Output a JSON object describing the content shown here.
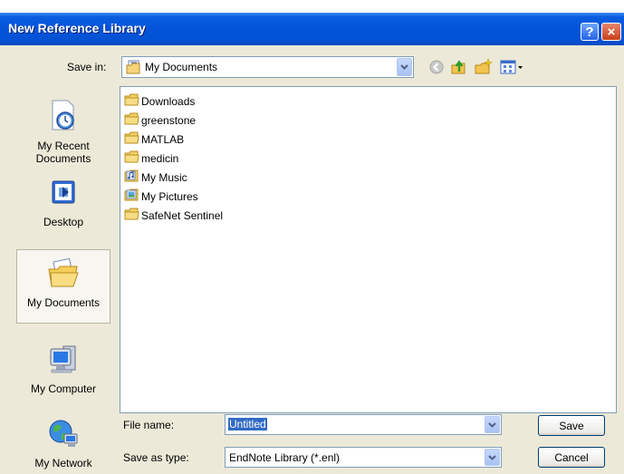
{
  "window": {
    "title": "New Reference Library",
    "help_label": "?",
    "close_label": "×"
  },
  "save_in": {
    "label": "Save in:",
    "value": "My Documents"
  },
  "places": [
    {
      "label": "My Recent Documents",
      "icon": "recent-documents-icon"
    },
    {
      "label": "Desktop",
      "icon": "desktop-icon"
    },
    {
      "label": "My Documents",
      "icon": "my-documents-icon",
      "selected": true
    },
    {
      "label": "My Computer",
      "icon": "my-computer-icon"
    },
    {
      "label": "My Network",
      "icon": "my-network-icon"
    }
  ],
  "files": [
    {
      "name": "Downloads",
      "icon": "folder-icon"
    },
    {
      "name": "greenstone",
      "icon": "folder-icon"
    },
    {
      "name": "MATLAB",
      "icon": "folder-icon"
    },
    {
      "name": "medicin",
      "icon": "folder-icon"
    },
    {
      "name": "My Music",
      "icon": "music-folder-icon"
    },
    {
      "name": "My Pictures",
      "icon": "pictures-folder-icon"
    },
    {
      "name": "SafeNet Sentinel",
      "icon": "folder-icon"
    }
  ],
  "file_name": {
    "label": "File name:",
    "value": "Untitled"
  },
  "save_as_type": {
    "label": "Save as type:",
    "value": "EndNote Library (*.enl)"
  },
  "buttons": {
    "save": "Save",
    "cancel": "Cancel"
  },
  "colors": {
    "titlebar": "#0453d8",
    "selection": "#316ac5",
    "dialog_bg": "#ece9d8"
  }
}
